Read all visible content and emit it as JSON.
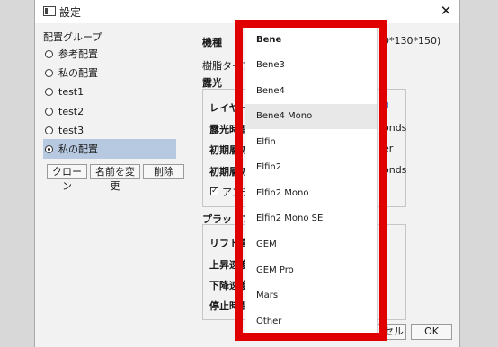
{
  "dialog": {
    "title": "設定",
    "close_glyph": "✕"
  },
  "config_group": {
    "title": "配置グループ",
    "items": [
      {
        "label": "参考配置",
        "selected": false
      },
      {
        "label": "私の配置",
        "selected": false
      },
      {
        "label": "test1",
        "selected": false
      },
      {
        "label": "test2",
        "selected": false
      },
      {
        "label": "test3",
        "selected": false
      },
      {
        "label": "私の配置",
        "selected": true
      }
    ],
    "buttons": {
      "clone": "クローン",
      "rename": "名前を変更",
      "delete": "削除"
    }
  },
  "settings": {
    "model_label": "機種",
    "model_value_suffix": "0*130*150)",
    "resin_type_label": "樹脂タイプ",
    "exposure_label": "露光",
    "layer_label": "レイヤーの",
    "exposure_time_label": "露光時間",
    "exposure_time_suffix": "onds",
    "initial_layer_label_1": "初期層の",
    "initial_layer_suffix_1": "er",
    "initial_layer_label_2": "初期層の",
    "initial_layer_suffix_2": "onds",
    "antialias_label": "アンチエ",
    "antialias_checked": true,
    "platform_label": "プラットフォー",
    "lift_height_label": "リフト高さ",
    "rise_speed_label": "上昇速度",
    "fall_speed_label": "下降速度",
    "stop_time_label": "停止時間"
  },
  "footer": {
    "cancel_partial": "セル",
    "ok": "OK"
  },
  "dropdown": {
    "items": [
      "Bene",
      "Bene3",
      "Bene4",
      "Bene4 Mono",
      "Elfin",
      "Elfin2",
      "Elfin2 Mono",
      "Elfin2 Mono SE",
      "GEM",
      "GEM Pro",
      "Mars",
      "Other"
    ],
    "highlighted": "Bene4 Mono"
  },
  "colors": {
    "highlight_frame": "#e00000",
    "selection": "#b6c9e0"
  }
}
